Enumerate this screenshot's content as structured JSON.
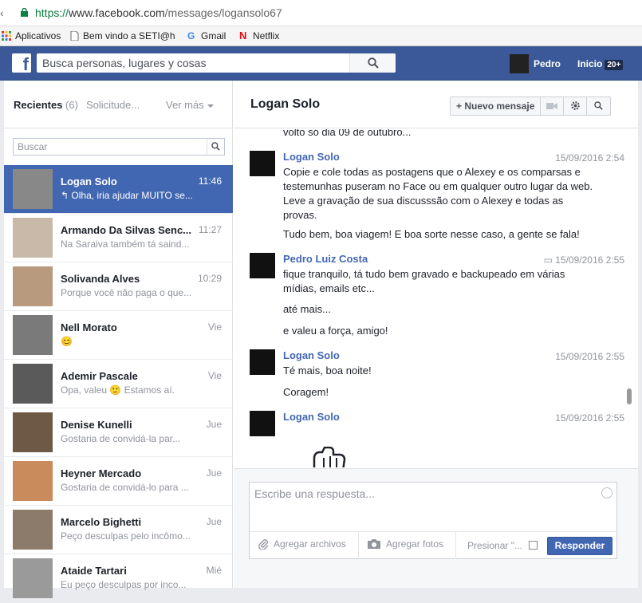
{
  "browser": {
    "url_proto": "https://",
    "url_host": "www.facebook.com",
    "url_path": "/messages/logansolo67",
    "bookmarks": [
      {
        "label": "Aplicativos",
        "icon": "apps-grid-icon"
      },
      {
        "label": "Bem vindo a SETI@hc",
        "icon": "page-icon"
      },
      {
        "label": "Gmail",
        "icon": "google-icon"
      },
      {
        "label": "Netflix",
        "icon": "netflix-icon"
      }
    ]
  },
  "header": {
    "logo": "f",
    "search_placeholder": "Busca personas, lugares y cosas",
    "user_name": "Pedro",
    "home_label": "Inicio",
    "home_badge": "20+"
  },
  "sidebar": {
    "tab_recent": "Recientes",
    "tab_recent_count": "(6)",
    "tab_requests": "Solicitude...",
    "tab_more": "Ver más",
    "search_placeholder": "Buscar",
    "threads": [
      {
        "name": "Logan Solo",
        "time": "11:46",
        "snippet": "↰ Olha, iria ajudar MUITO se...",
        "active": true
      },
      {
        "name": "Armando Da Silvas Senc...",
        "time": "11:27",
        "snippet": "Na Saraiva também tá saind..."
      },
      {
        "name": "Solivanda Alves",
        "time": "10:29",
        "snippet": "Porque você não paga o que..."
      },
      {
        "name": "Nell Morato",
        "time": "Vie",
        "snippet": "😊"
      },
      {
        "name": "Ademir Pascale",
        "time": "Vie",
        "snippet": "Opa, valeu 🙂 Estamos aí."
      },
      {
        "name": "Denise Kunelli",
        "time": "Jue",
        "snippet": "Gostaria de convidá-la par..."
      },
      {
        "name": "Heyner Mercado",
        "time": "Jue",
        "snippet": "Gostaria de convidá-lo para ..."
      },
      {
        "name": "Marcelo Bighetti",
        "time": "Jue",
        "snippet": "Peço desculpas pelo incômo..."
      },
      {
        "name": "Ataide Tartari",
        "time": "Mié",
        "snippet": "Eu peço desculpas por inco..."
      }
    ]
  },
  "conversation": {
    "title": "Logan Solo",
    "new_message_label": "Nuevo mensaje",
    "cut_line": "volto só dia 09 de outubro...",
    "groups": [
      {
        "sender": "Logan Solo",
        "time": "15/09/2016 2:54",
        "lines": [
          "Copie e cole todas as postagens que o Alexey e os comparsas e testemunhas puseram no Face ou em qualquer outro lugar da web. Leve a gravação de sua discusssão com o Alexey e todas as provas.",
          "Tudo bem, boa viagem! E boa sorte nesse caso, a gente se fala!"
        ]
      },
      {
        "sender": "Pedro Luiz Costa",
        "time": "15/09/2016 2:55",
        "lines": [
          "fique tranquilo, tá tudo bem gravado e backupeado em várias mídias, emails etc...",
          "até mais...",
          "e valeu a força, amigo!"
        ]
      },
      {
        "sender": "Logan Solo",
        "time": "15/09/2016 2:55",
        "lines": [
          "Té mais, boa noite!",
          "Coragem!"
        ]
      },
      {
        "sender": "Logan Solo",
        "time": "15/09/2016 2:55",
        "lines": []
      }
    ],
    "reply_placeholder": "Escribe una respuesta...",
    "attach_files": "Agregar archivos",
    "attach_photos": "Agregar fotos",
    "press_enter": "Presionar \"...",
    "reply_button": "Responder"
  },
  "colors": {
    "fb_blue": "#3b5998",
    "active_thread": "#4267b2",
    "name_link": "#4267b2"
  }
}
